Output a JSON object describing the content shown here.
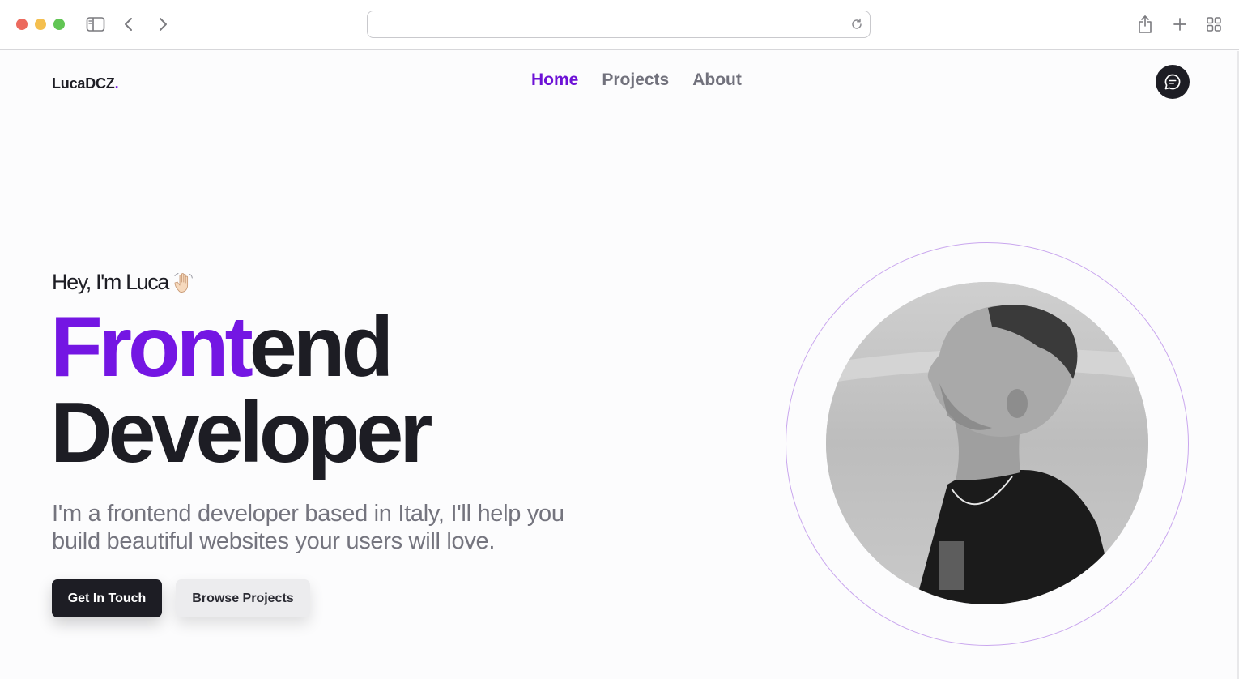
{
  "browser": {
    "address": "",
    "icons": {
      "sidebar": "sidebar-toggle-icon",
      "back": "chevron-left-icon",
      "forward": "chevron-right-icon",
      "reload": "reload-icon",
      "share": "share-icon",
      "new_tab": "plus-icon",
      "tab_overview": "grid-icon"
    }
  },
  "site": {
    "logo_text": "LucaDCZ",
    "logo_dot": ".",
    "nav": [
      {
        "label": "Home",
        "active": true
      },
      {
        "label": "Projects",
        "active": false
      },
      {
        "label": "About",
        "active": false
      }
    ],
    "chat_icon": "chat-icon"
  },
  "hero": {
    "greeting": "Hey, I'm Luca",
    "greeting_icon": "waving-hand-icon",
    "headline_accent": "Front",
    "headline_rest": "end",
    "headline_line2": "Developer",
    "tagline_line1": "I'm a frontend developer based in Italy, I'll help you",
    "tagline_line2": "build beautiful websites your users will love.",
    "primary_button": "Get In Touch",
    "secondary_button": "Browse Projects"
  },
  "colors": {
    "accent": "#7416e3",
    "dark": "#1d1d24",
    "muted": "#74747e",
    "ring": "#c9a6ee"
  }
}
